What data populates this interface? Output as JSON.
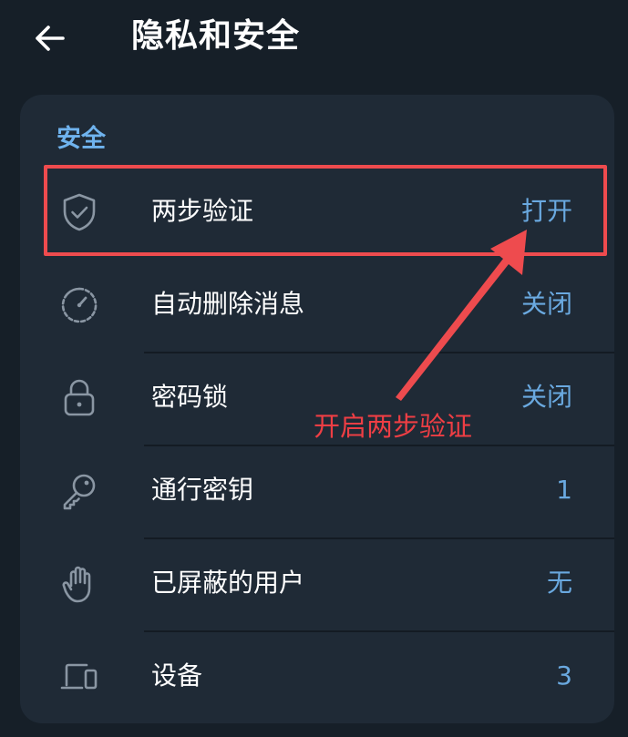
{
  "header": {
    "title": "隐私和安全",
    "back_icon": "arrow-left-icon"
  },
  "section": {
    "title": "安全"
  },
  "items": [
    {
      "label": "两步验证",
      "value": "打开",
      "icon": "shield-check-icon"
    },
    {
      "label": "自动删除消息",
      "value": "关闭",
      "icon": "timer-icon"
    },
    {
      "label": "密码锁",
      "value": "关闭",
      "icon": "lock-icon"
    },
    {
      "label": "通行密钥",
      "value": "1",
      "icon": "key-icon"
    },
    {
      "label": "已屏蔽的用户",
      "value": "无",
      "icon": "hand-icon"
    },
    {
      "label": "设备",
      "value": "3",
      "icon": "devices-icon"
    }
  ],
  "annotation": {
    "text": "开启两步验证",
    "color": "#ee3e44"
  },
  "colors": {
    "background": "#161f28",
    "card": "#1f2a36",
    "accent": "#6fb3ee",
    "value": "#6aa9e0",
    "highlight": "#ee4b4e"
  }
}
